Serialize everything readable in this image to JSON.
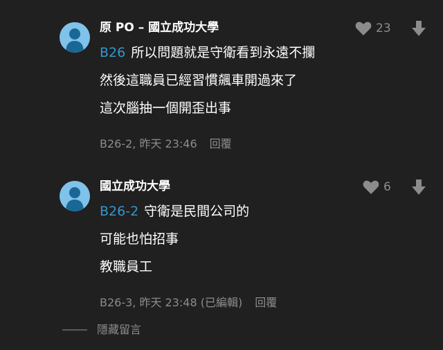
{
  "comments": [
    {
      "author": "原 PO – 國立成功大學",
      "likes": "23",
      "reply_tag": "B26",
      "lines": [
        "所以問題就是守衛看到永遠不攔",
        "然後這職員已經習慣飆車開過來了",
        "這次腦抽一個開歪出事"
      ],
      "meta": "B26-2, 昨天 23:46",
      "reply_label": "回覆"
    },
    {
      "author": "國立成功大學",
      "likes": "6",
      "reply_tag": "B26-2",
      "lines": [
        "守衛是民間公司的",
        "可能也怕招事",
        "教職員工"
      ],
      "meta": "B26-3, 昨天 23:48 (已編輯)",
      "reply_label": "回覆"
    }
  ],
  "hide_comments_label": "隱藏留言",
  "icons": {
    "avatar": "user-avatar-icon",
    "like": "heart-icon",
    "downvote": "arrow-down-icon"
  },
  "colors": {
    "background": "#202020",
    "avatar": "#7fc2ea",
    "accent": "#3397cf",
    "muted": "#8c8c8c"
  }
}
